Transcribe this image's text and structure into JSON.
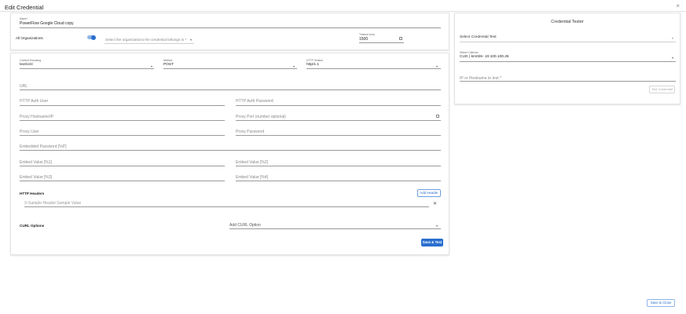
{
  "dialog": {
    "title": "Edit Credential",
    "close_glyph": "×"
  },
  "top": {
    "name": {
      "label": "Name*",
      "value": "PowerFlow Google Cloud copy"
    },
    "all_orgs_label": "All Organizations",
    "all_orgs_on": true,
    "org_select": {
      "placeholder": "Select the organizations the credential belongs to *"
    },
    "timeout": {
      "label": "Timeout (ms)",
      "value": "1500"
    }
  },
  "form": {
    "content_encoding": {
      "label": "Content Encoding",
      "value": "text/xml"
    },
    "method": {
      "label": "Method",
      "value": "POST"
    },
    "http_version": {
      "label": "HTTP Version",
      "value": "http/1.1"
    },
    "url": {
      "placeholder": "URL"
    },
    "http_auth_user": {
      "placeholder": "HTTP Auth User"
    },
    "http_auth_password": {
      "placeholder": "HTTP Auth Password"
    },
    "proxy_hostname": {
      "placeholder": "Proxy Hostname/IP"
    },
    "proxy_port": {
      "placeholder": "Proxy Port (number optional)"
    },
    "proxy_user": {
      "placeholder": "Proxy User"
    },
    "proxy_password": {
      "placeholder": "Proxy Password"
    },
    "embedded_password": {
      "placeholder": "Embedded Password [%P]"
    },
    "embed_value_1": {
      "placeholder": "Embed Value [%1]"
    },
    "embed_value_2": {
      "placeholder": "Embed Value [%2]"
    },
    "embed_value_3": {
      "placeholder": "Embed Value [%3]"
    },
    "embed_value_4": {
      "placeholder": "Embed Value [%4]"
    },
    "http_headers": {
      "title": "HTTP Headers",
      "add_label": "Add Header",
      "row_placeholder": "X-Sample-Header:Sample Value",
      "remove_glyph": "✕"
    },
    "curl_options": {
      "title": "CURL Options",
      "placeholder": "Add CURL Option"
    },
    "save_test_label": "Save & Test"
  },
  "tester": {
    "title": "Credential Tester",
    "test_select": {
      "placeholder": "Select Credential Test"
    },
    "collector": {
      "label": "Select Collector",
      "value": "CUG | km026- 10.100.100.26"
    },
    "ip_host": {
      "placeholder": "IP or Hostname to test *"
    },
    "test_button_label": "Test Credential"
  },
  "footer": {
    "save_close_label": "Save & Close"
  },
  "colors": {
    "accent": "#2a6fcf"
  },
  "icons": {
    "caret": "caret-down-icon",
    "calendar": "calendar-icon",
    "close": "close-icon"
  }
}
